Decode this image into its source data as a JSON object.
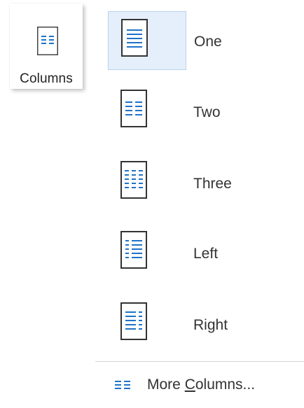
{
  "ribbon": {
    "columns_label": "Columns",
    "icon": "columns-icon"
  },
  "menu": {
    "items": [
      {
        "label": "One",
        "icon": "one-column-icon",
        "selected": true
      },
      {
        "label": "Two",
        "icon": "two-columns-icon",
        "selected": false
      },
      {
        "label": "Three",
        "icon": "three-columns-icon",
        "selected": false
      },
      {
        "label": "Left",
        "icon": "left-column-icon",
        "selected": false
      },
      {
        "label": "Right",
        "icon": "right-column-icon",
        "selected": false
      }
    ],
    "more": {
      "label_pre": "More ",
      "label_accel": "C",
      "label_post": "olumns...",
      "icon": "more-columns-icon"
    }
  },
  "colors": {
    "accent": "#1e73c8",
    "selected_bg": "#e5effb",
    "selected_border": "#b9d1ee",
    "text": "#333333"
  }
}
